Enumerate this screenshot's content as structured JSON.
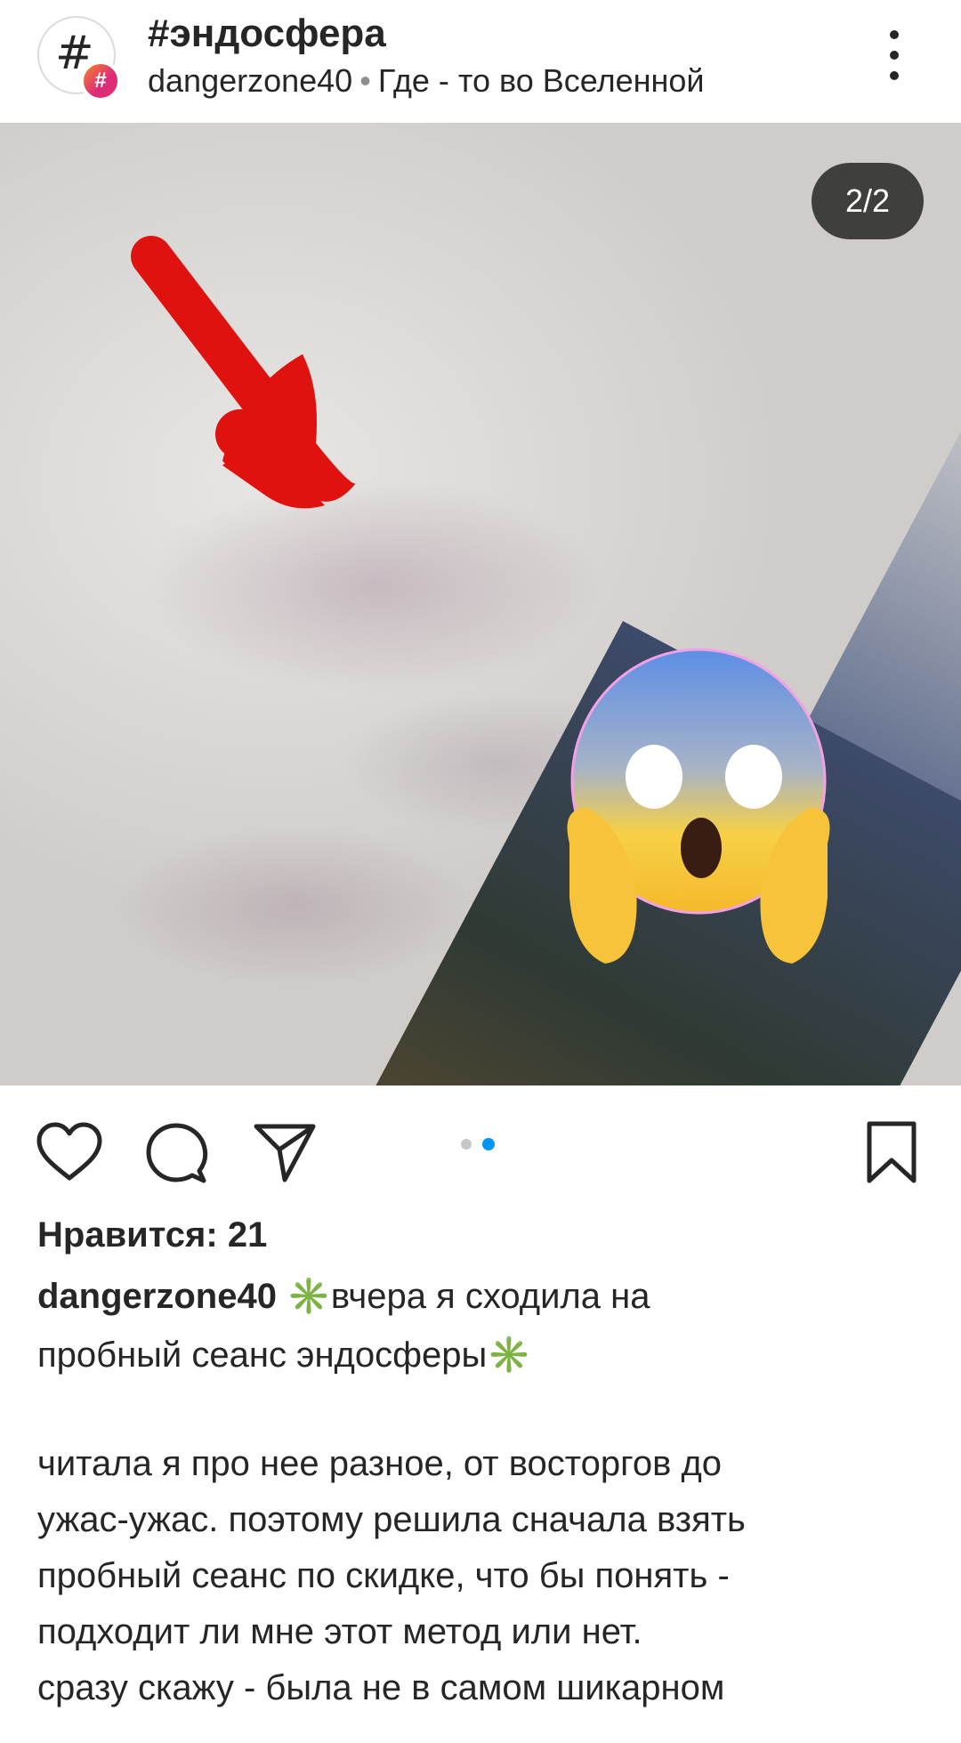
{
  "header": {
    "title": "#эндосфера",
    "username": "dangerzone40",
    "separator": "•",
    "location": "Где - то во Вселенной",
    "avatar_symbol": "#",
    "avatar_badge": "#",
    "more_icon": "more-vertical-icon"
  },
  "photo": {
    "counter": "2/2"
  },
  "actions": {
    "like_icon": "heart-icon",
    "comment_icon": "comment-icon",
    "share_icon": "send-icon",
    "save_icon": "bookmark-icon",
    "carousel_index": 2,
    "carousel_total": 2
  },
  "post": {
    "likes": "Нравится: 21",
    "caption_user": "dangerzone40",
    "caption_sparkle": "✳️",
    "caption_text_1": "вчера я сходила на",
    "caption_text_2": "пробный сеанс эндосферы",
    "body": "читала я про нее разное, от восторгов до\nужас-ужас. поэтому решила сначала взять\nпробный сеанс по скидке, что бы понять -\nподходит ли мне этот метод или нет.\nсразу скажу - была не в самом шикарном"
  },
  "colors": {
    "accent_blue": "#0095f6",
    "sparkle_green": "#5cb85c",
    "text": "#262626",
    "arrow_red": "#e0120f"
  }
}
